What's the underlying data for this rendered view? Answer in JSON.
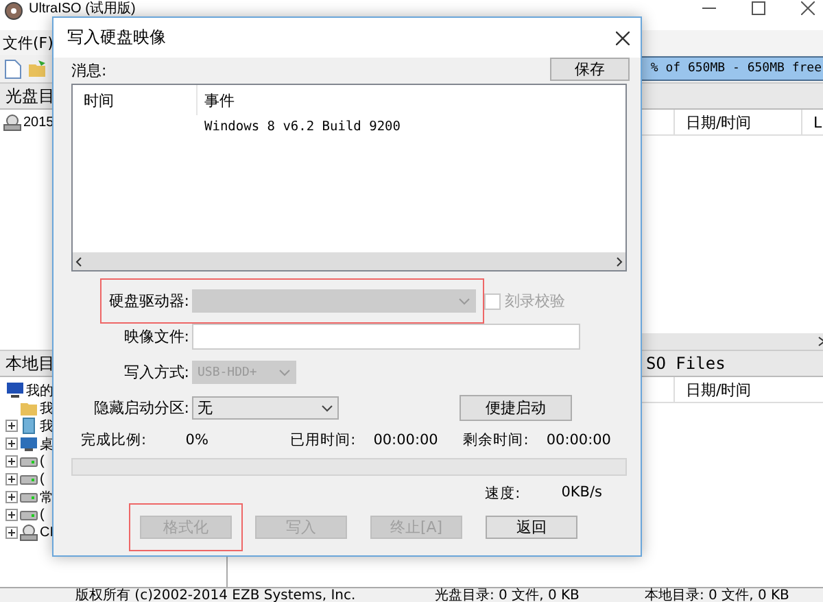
{
  "app": {
    "title": "UltraISO (试用版)",
    "menu": [
      "文件(F)"
    ],
    "capacity": "% of 650MB - 650MB free",
    "upper_left": {
      "header": "光盘目",
      "items": [
        "2015"
      ]
    },
    "upper_right": {
      "columns": [
        "日期/时间",
        "L"
      ]
    },
    "lower_left": {
      "header": "本地目",
      "tree": [
        {
          "label": "我的",
          "kind": "computer",
          "children": [
            {
              "label": "我",
              "kind": "folder"
            },
            {
              "label": "我",
              "kind": "document",
              "expanded": false
            },
            {
              "label": "桌",
              "kind": "desktop",
              "expanded": false
            },
            {
              "label": "(",
              "kind": "drive",
              "expanded": false
            },
            {
              "label": "(",
              "kind": "drive",
              "expanded": false
            },
            {
              "label": "常",
              "kind": "drive",
              "expanded": false
            },
            {
              "label": "(",
              "kind": "drive",
              "expanded": false
            },
            {
              "label": "CI",
              "kind": "cdrom",
              "expanded": false
            }
          ]
        }
      ]
    },
    "lower_right": {
      "header": "SO Files",
      "columns": [
        "日期/时间"
      ]
    },
    "status_bar": [
      "版权所有 (c)2002-2014 EZB Systems, Inc.",
      "光盘目录: 0 文件, 0 KB",
      "本地目录: 0 文件, 0 KB"
    ]
  },
  "dialog": {
    "title": "写入硬盘映像",
    "messages_label": "消息:",
    "save_button": "保存",
    "log": {
      "columns": [
        "时间",
        "事件"
      ],
      "rows": [
        {
          "event": "Windows 8 v6.2 Build 9200"
        }
      ]
    },
    "fields": [
      {
        "kind": "select",
        "label": "硬盘驱动器:",
        "disabled": true,
        "highlighted": true
      },
      {
        "kind": "input",
        "label": "映像文件:",
        "highlighted": false
      },
      {
        "kind": "select",
        "label": "写入方式:",
        "value": "USB-HDD+",
        "disabled": true,
        "highlighted": false
      },
      {
        "kind": "select",
        "label": "隐藏启动分区:",
        "value": "无",
        "disabled": false,
        "highlighted": false
      }
    ],
    "verify": {
      "label": "刻录校验",
      "checked": false,
      "disabled": true
    },
    "quick_boot_button": "便捷启动",
    "stats": [
      {
        "label": "完成比例:",
        "value": "0%"
      },
      {
        "label": "已用时间:",
        "value": "00:00:00"
      },
      {
        "label": "剩余时间:",
        "value": "00:00:00"
      }
    ],
    "progress": {
      "level": 0
    },
    "speed": {
      "label": "速度:",
      "value": "0KB/s"
    },
    "buttons": [
      {
        "label": "格式化",
        "disabled": true,
        "highlighted": true
      },
      {
        "label": "写入",
        "disabled": true,
        "highlighted": false
      },
      {
        "label": "终止[A]",
        "disabled": true,
        "highlighted": false
      },
      {
        "label": "返回",
        "disabled": false,
        "highlighted": false
      }
    ]
  }
}
